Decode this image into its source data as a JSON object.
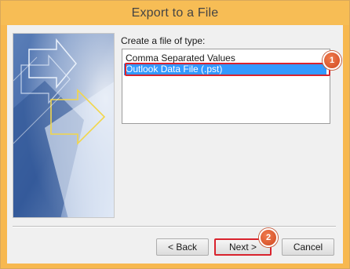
{
  "window": {
    "title": "Export to a File"
  },
  "file_type": {
    "prompt": "Create a file of type:",
    "options": [
      "Comma Separated Values",
      "Outlook Data File (.pst)"
    ],
    "selected": "Outlook Data File (.pst)"
  },
  "annotations": {
    "step1": "1",
    "step2": "2"
  },
  "buttons": {
    "back": "< Back",
    "next": "Next >",
    "cancel": "Cancel"
  },
  "colors": {
    "titlebar": "#f7bd55",
    "selection": "#3399ff",
    "highlight": "#d9232d",
    "badge": "#e05a2e"
  }
}
